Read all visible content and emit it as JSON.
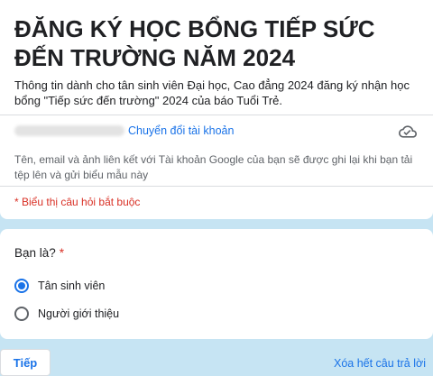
{
  "form": {
    "title": "ĐĂNG KÝ HỌC BỔNG TIẾP SỨC ĐẾN TRƯỜNG NĂM 2024",
    "description": "Thông tin dành cho tân sinh viên Đại học, Cao đẳng 2024 đăng ký nhận học bổng \"Tiếp sức đến trường\" 2024 của báo Tuổi Trẻ."
  },
  "account": {
    "switch_label": "Chuyển đổi tài khoản",
    "note": "Tên, email và ảnh liên kết với Tài khoản Google của bạn sẽ được ghi lại khi bạn tải tệp lên và gửi biểu mẫu này",
    "cloud_icon": "cloud-icon"
  },
  "required_note": "* Biểu thị câu hỏi bắt buộc",
  "question": {
    "label": "Bạn là?",
    "required_marker": "*",
    "options": [
      {
        "label": "Tân sinh viên",
        "selected": true
      },
      {
        "label": "Người giới thiệu",
        "selected": false
      }
    ]
  },
  "footer": {
    "next_label": "Tiếp",
    "clear_label": "Xóa hết câu trả lời"
  },
  "colors": {
    "accent": "#1a73e8",
    "required": "#d93025",
    "background": "#c6e4f3"
  }
}
